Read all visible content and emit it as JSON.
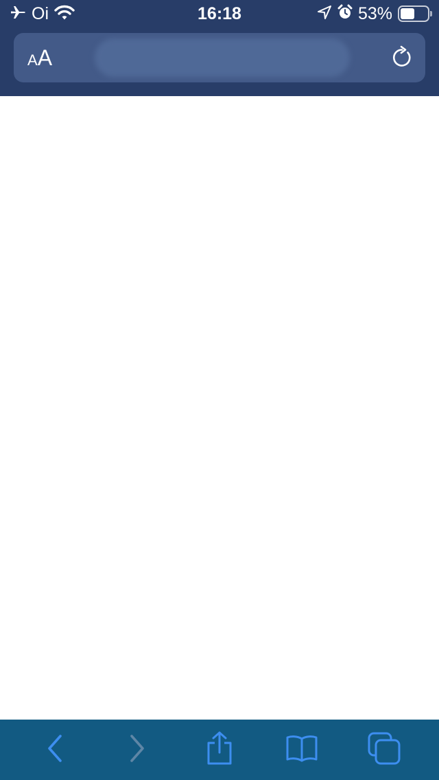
{
  "status_bar": {
    "carrier": "Oi",
    "time": "16:18",
    "battery_percent_label": "53%",
    "battery_level": 0.53,
    "icons": [
      "airplane-icon",
      "wifi-icon",
      "location-arrow-icon",
      "alarm-icon",
      "battery-icon"
    ]
  },
  "address_bar": {
    "text_size_small": "A",
    "text_size_large": "A",
    "reload_icon": "reload-icon"
  },
  "toolbar": {
    "buttons": [
      "back-icon",
      "forward-icon",
      "share-icon",
      "bookmarks-icon",
      "tabs-icon"
    ]
  },
  "colors": {
    "top_bar": "#283d68",
    "url_field": "#435a88",
    "toolbar": "#125a82",
    "accent": "#3d8ef0",
    "disabled": "#5e86a6"
  }
}
